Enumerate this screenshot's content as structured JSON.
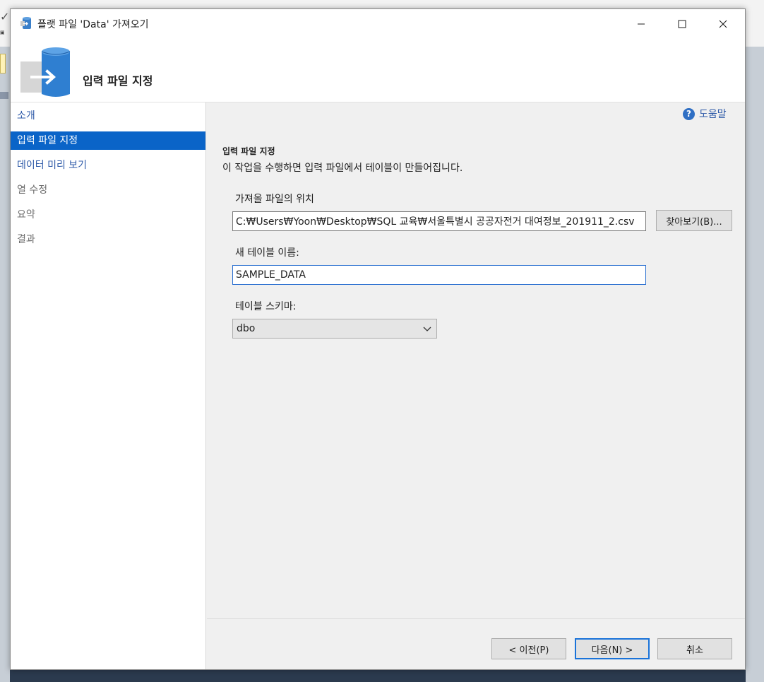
{
  "window": {
    "title": "플랫 파일 'Data' 가져오기",
    "header_title": "입력 파일 지정"
  },
  "nav": {
    "items": [
      {
        "label": "소개",
        "state": "link"
      },
      {
        "label": "입력 파일 지정",
        "state": "active"
      },
      {
        "label": "데이터 미리 보기",
        "state": "link"
      },
      {
        "label": "열 수정",
        "state": "disabled"
      },
      {
        "label": "요약",
        "state": "disabled"
      },
      {
        "label": "결과",
        "state": "disabled"
      }
    ]
  },
  "help": {
    "label": "도움말"
  },
  "section": {
    "title": "입력 파일 지정",
    "description": "이 작업을 수행하면 입력 파일에서 테이블이 만들어집니다."
  },
  "file_location": {
    "label": "가져올 파일의 위치",
    "value": "C:₩Users₩Yoon₩Desktop₩SQL 교육₩서울특별시 공공자전거 대여정보_201911_2.csv",
    "browse_label": "찾아보기(B)..."
  },
  "table_name": {
    "label": "새 테이블 이름:",
    "value": "SAMPLE_DATA"
  },
  "schema": {
    "label": "테이블 스키마:",
    "value": "dbo"
  },
  "footer": {
    "prev_label": "< 이전(P)",
    "next_label": "다음(N) >",
    "cancel_label": "취소"
  },
  "colors": {
    "accent": "#0a64c8",
    "link": "#2e5aa8",
    "focus_border": "#2a6fd0"
  }
}
